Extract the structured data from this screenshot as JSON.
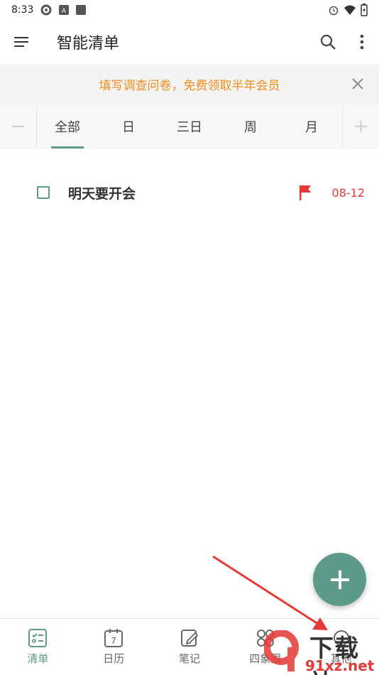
{
  "status_bar": {
    "time": "8:33"
  },
  "app_bar": {
    "title": "智能清单"
  },
  "banner": {
    "text": "填写调查问卷，免费领取半年会员"
  },
  "tabs": {
    "minus": "−",
    "plus": "+",
    "items": [
      {
        "label": "全部",
        "active": true
      },
      {
        "label": "日"
      },
      {
        "label": "三日"
      },
      {
        "label": "周"
      },
      {
        "label": "月"
      }
    ]
  },
  "tasks": [
    {
      "title": "明天要开会",
      "date": "08-12",
      "flag_color": "#e53935"
    }
  ],
  "bottom_nav": {
    "items": [
      {
        "label": "清单",
        "active": true
      },
      {
        "label": "日历",
        "calendar_day": "7"
      },
      {
        "label": "笔记"
      },
      {
        "label": "四象限"
      },
      {
        "label": "其他"
      }
    ]
  },
  "watermark": {
    "brand": "下载站",
    "url": "91xz.net"
  },
  "colors": {
    "accent": "#5e9a8a",
    "banner_text": "#f08c1c",
    "due": "#e53935"
  }
}
